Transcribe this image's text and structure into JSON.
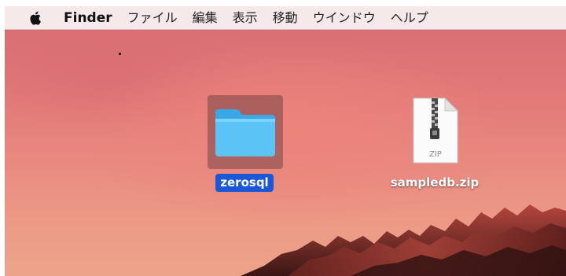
{
  "menubar": {
    "apple_icon": "apple-logo-icon",
    "app_name": "Finder",
    "items": [
      "ファイル",
      "編集",
      "表示",
      "移動",
      "ウインドウ",
      "ヘルプ"
    ]
  },
  "desktop": {
    "folder": {
      "name": "zerosql",
      "icon": "folder-icon",
      "selected": true,
      "color": "#5cc3f7"
    },
    "zip_file": {
      "name": "sampledb.zip",
      "icon": "zip-archive-icon",
      "type_label": "ZIP"
    }
  },
  "colors": {
    "selection_label_bg": "#1b58d8",
    "selection_icon_bg": "#7a4646",
    "menubar_bg": "#f6e8e9",
    "wallpaper_top": "#d96f74",
    "wallpaper_bottom": "#eda38a"
  }
}
